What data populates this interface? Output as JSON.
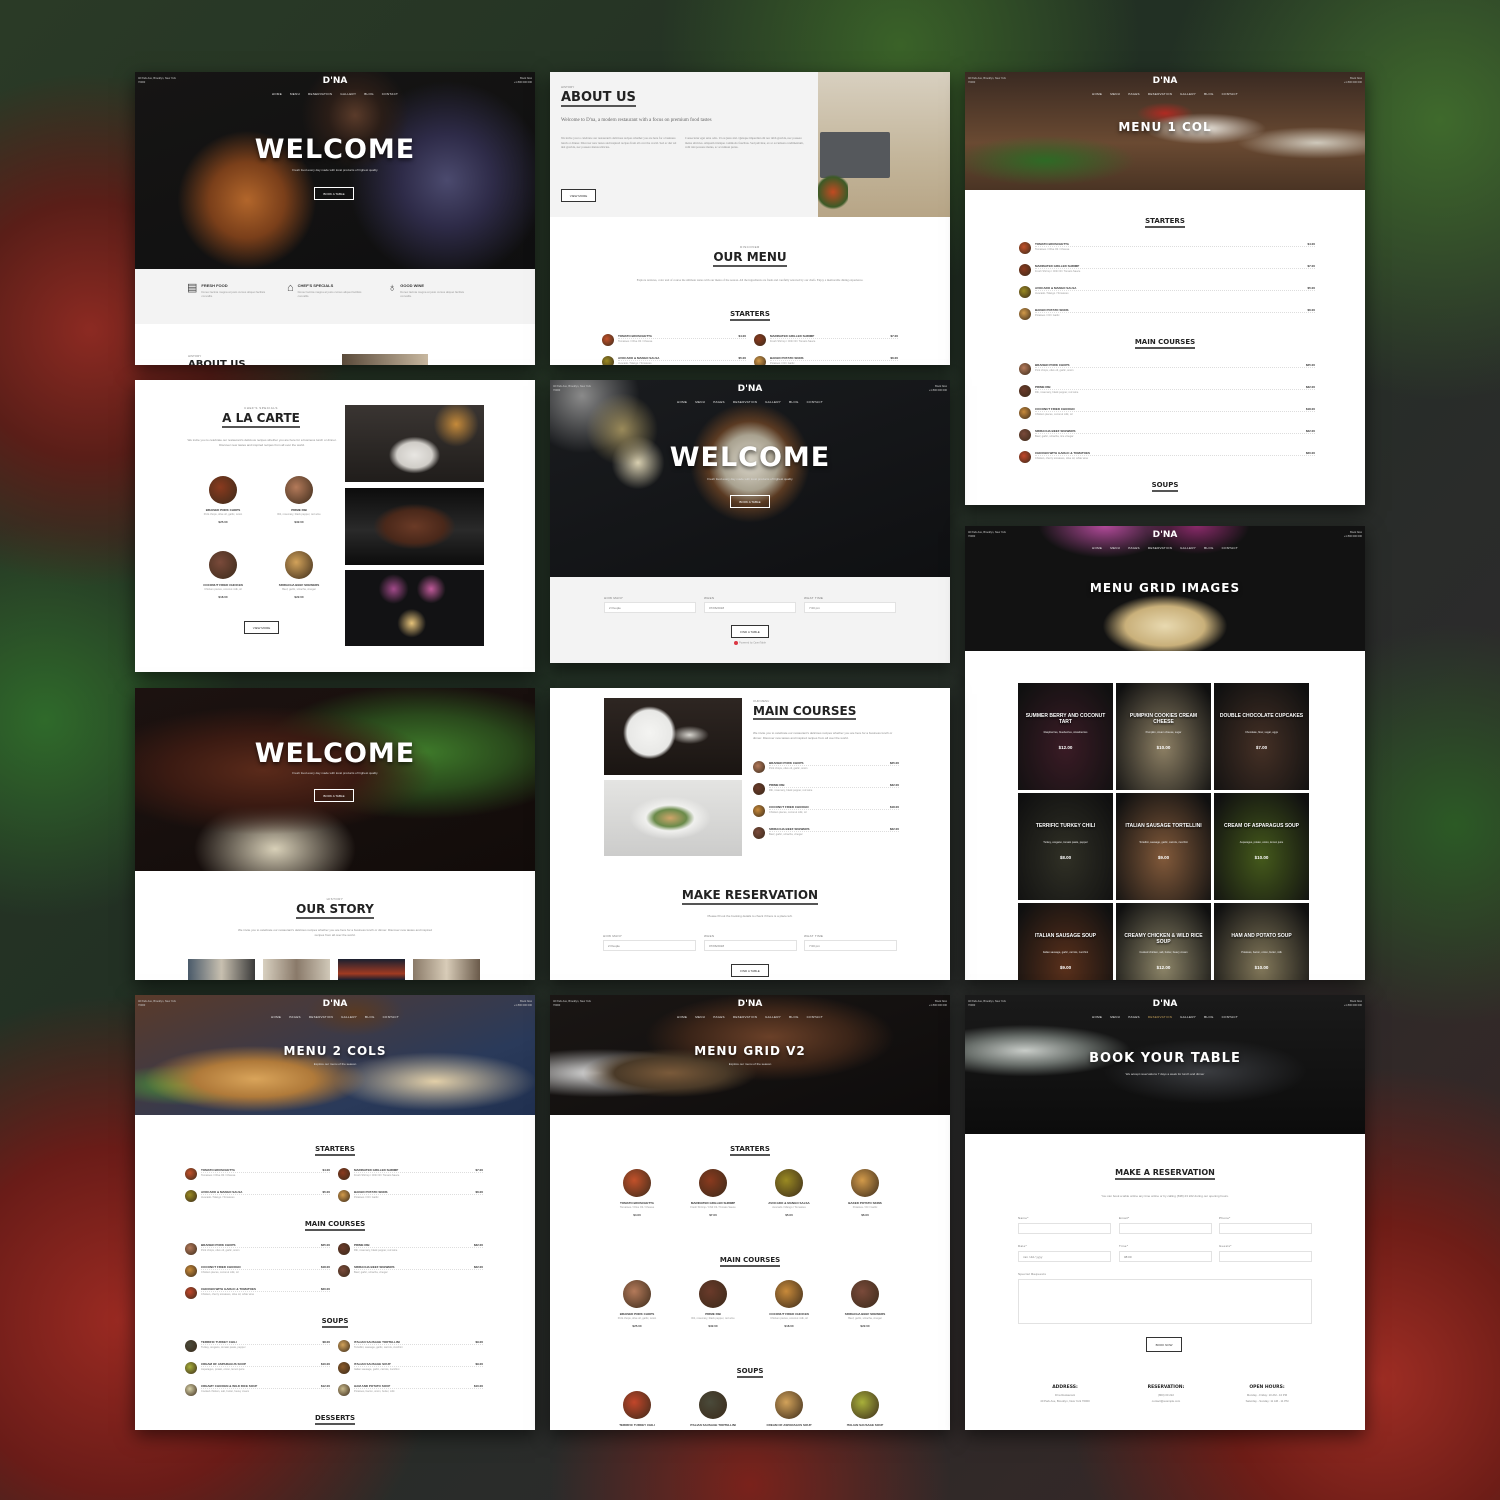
{
  "brand": {
    "logo": "D'NA"
  },
  "nav": {
    "items": [
      "HOME",
      "MENU",
      "PAGES",
      "RESERVATION",
      "GALLERY",
      "BLOG",
      "CONTACT"
    ],
    "address": "40 Park Ave, Brooklyn, New York 70000",
    "hours_label": "Book Now",
    "phone": "+1 800 000 000"
  },
  "cards": {
    "home1": {
      "hero_title": "WELCOME",
      "hero_subtitle": "Fresh food every day made with local products of highest quality",
      "hero_button": "BOOK A TABLE",
      "features": [
        {
          "icon": "fresh-food-icon",
          "glyph": "🥫",
          "title": "FRESH FOOD",
          "desc": "Donec lacinia magna at justo cursus aliquet facilisis convallis."
        },
        {
          "icon": "cloche-icon",
          "glyph": "🛎",
          "title": "CHEF'S SPECIALS",
          "desc": "Donec lacinia magna at justo cursus aliquet facilisis convallis."
        },
        {
          "icon": "wine-glass-icon",
          "glyph": "🍷",
          "title": "GOOD WINE",
          "desc": "Donec lacinia magna at justo cursus aliquet facilisis convallis."
        }
      ],
      "footer_kicker": "HISTORY",
      "footer_title": "ABOUT US"
    },
    "about": {
      "kicker": "HISTORY",
      "title": "ABOUT US",
      "lead": "Welcome to D'na, a modern restaurant with a focus on premium food tastes",
      "col1": "We invite you to celebrate our restaurant's delicious recipes whether you are here for a business lunch or dinner. Discover new tastes and inspired recipes from all over the world. Sed ac dui vel nisl gravida, nec posuere metus ultricies.",
      "col2": "Consectetur eget urna odio. Ut eu justo nisl. Quisque imperdiet elit nec nibh gravida, nec posuere metus ultricies. Aliquam tristique commodo faucibus. Sed pulvinar, ex ac accumsan condimentum, velit nisi posuere metus, ac accumsan purus.",
      "button": "VIEW MORE",
      "menu_kicker": "DISCOVER",
      "menu_title": "OUR MENU",
      "menu_desc": "Explore textures, color and of course the ultimate tastes with our menu of the season. All the ingredients are fresh and carefully selected by our chefs. Enjoy a memorable dining experience.",
      "starters_title": "STARTERS",
      "starters": [
        {
          "name": "TOMATO BRUSCHETTA",
          "desc": "Tomatoes / Olive Oil / Cheese",
          "price": "$4.00"
        },
        {
          "name": "MARINATED GRILLED SHRIMP",
          "desc": "Fresh Shrimp / Chili Oil / Tomato Sauce",
          "price": "$7.00"
        },
        {
          "name": "AVOCADO & MANGO SALSA",
          "desc": "Avocado / Mango / Tomatoes",
          "price": "$5.00"
        },
        {
          "name": "BAKED POTATO SKINS",
          "desc": "Potatoes / Oil / Garlic",
          "price": "$6.00"
        }
      ]
    },
    "menu1col": {
      "title": "MENU 1 COL",
      "sections": [
        {
          "title": "STARTERS",
          "items": [
            {
              "name": "TOMATO BRUSCHETTA",
              "desc": "Tomatoes / Olive Oil / Cheese",
              "price": "$4.00"
            },
            {
              "name": "MARINATED GRILLED SHRIMP",
              "desc": "Fresh Shrimp / Chili Oil / Tomato Sauce",
              "price": "$7.00"
            },
            {
              "name": "AVOCADO & MANGO SALSA",
              "desc": "Avocado / Mango / Tomatoes",
              "price": "$5.00"
            },
            {
              "name": "BAKED POTATO SKINS",
              "desc": "Potatoes / Oil / Garlic",
              "price": "$6.00"
            }
          ]
        },
        {
          "title": "MAIN COURSES",
          "items": [
            {
              "name": "BRAISED PORK CHOPS",
              "desc": "Pork chops, olive oil, garlic, onion",
              "price": "$25.00"
            },
            {
              "name": "PRIME RIB",
              "desc": "Rib, rosemary, black pepper, red wine",
              "price": "$32.00"
            },
            {
              "name": "COCONUT FRIED CHICKEN",
              "desc": "Chicken pieces, coconut milk, oil",
              "price": "$18.00"
            },
            {
              "name": "SRIRACHA BEEF SKEWERS",
              "desc": "Beef, garlic, sriracha, rice vinegar",
              "price": "$22.00"
            },
            {
              "name": "CHICKEN WITH GARLIC & TOMATOES",
              "desc": "Chicken, cherry tomatoes, olive oil, white wine",
              "price": "$20.00"
            }
          ]
        },
        {
          "title": "SOUPS",
          "items": []
        }
      ]
    },
    "alacarte": {
      "kicker": "CHEF'S SPECIALS",
      "title": "A LA CARTE",
      "desc": "We invite you to celebrate our restaurant's delicious recipes whether you are here for a business lunch or dinner. Discover new tastes and inspired recipes from all over the world.",
      "items": [
        {
          "name": "BRAISED PORK CHOPS",
          "desc": "Pork chops, olive oil, garlic, onion",
          "price": "$25.00"
        },
        {
          "name": "PRIME RIB",
          "desc": "Rib, rosemary, black pepper, red wine",
          "price": "$32.00"
        },
        {
          "name": "COCONUT FRIED CHICKEN",
          "desc": "Chicken pieces, coconut milk, oil",
          "price": "$18.00"
        },
        {
          "name": "SRIRACHA BEEF SKEWERS",
          "desc": "Beef, garlic, sriracha, vinegar",
          "price": "$22.00"
        }
      ],
      "button": "VIEW MORE"
    },
    "home2": {
      "hero_title": "WELCOME",
      "hero_subtitle": "Fresh food every day made with local products of highest quality",
      "hero_button": "BOOK A TABLE",
      "form": {
        "how_many_label": "HOW MANY",
        "how_many_value": "2 People",
        "when_label": "WHEN",
        "when_value": "07/06/2018",
        "time_label": "WHAT TIME",
        "time_value": "7:00 pm",
        "button": "FIND A TABLE",
        "powered": "Powered by OpenTable"
      }
    },
    "menugrid": {
      "title": "MENU GRID IMAGES",
      "items": [
        {
          "name": "SUMMER BERRY AND COCONUT TART",
          "desc": "Raspberries, blueberries, strawberries",
          "price": "$12.00"
        },
        {
          "name": "PUMPKIN COOKIES CREAM CHEESE",
          "desc": "Pumpkin, cream cheese, sugar",
          "price": "$10.00"
        },
        {
          "name": "DOUBLE CHOCOLATE CUPCAKES",
          "desc": "Chocolate, flour, sugar, eggs",
          "price": "$7.00"
        },
        {
          "name": "TERRIFIC TURKEY CHILI",
          "desc": "Turkey, oregano, tomato paste, pepper",
          "price": "$8.00"
        },
        {
          "name": "ITALIAN SAUSAGE TORTELLINI",
          "desc": "Tortellini, sausage, garlic, carrots, zucchini",
          "price": "$9.00"
        },
        {
          "name": "CREAM OF ASPARAGUS SOUP",
          "desc": "Asparagus, potato, onion, lemon juice",
          "price": "$10.00"
        },
        {
          "name": "ITALIAN SAUSAGE SOUP",
          "desc": "Italian sausage, garlic, carrots, zucchini",
          "price": "$9.00"
        },
        {
          "name": "CREAMY CHICKEN & WILD RICE SOUP",
          "desc": "Cooked chicken, salt, butter, heavy cream",
          "price": "$12.00"
        },
        {
          "name": "HAM AND POTATO SOUP",
          "desc": "Potatoes, bacon, onion, butter, milk",
          "price": "$10.00"
        }
      ]
    },
    "home3": {
      "hero_title": "WELCOME",
      "hero_subtitle": "Fresh food every day made with local products of highest quality",
      "hero_button": "BOOK A TABLE",
      "kicker": "HISTORY",
      "title": "OUR STORY",
      "desc": "We invite you to celebrate our restaurant's delicious recipes whether you are here for a business lunch or dinner. Discover new tastes and inspired recipes from all over the world."
    },
    "mains": {
      "kicker": "OUR MENU",
      "title": "MAIN COURSES",
      "desc": "We invite you to celebrate our restaurant's delicious recipes whether you are here for a business lunch or dinner. Discover new tastes and inspired recipes from all over the world.",
      "items": [
        {
          "name": "BRAISED PORK CHOPS",
          "desc": "Pork chops, olive oil, garlic, onion",
          "price": "$25.00"
        },
        {
          "name": "PRIME RIB",
          "desc": "Rib, rosemary, black pepper, red wine",
          "price": "$32.00"
        },
        {
          "name": "COCONUT FRIED CHICKEN",
          "desc": "Chicken pieces, coconut milk, oil",
          "price": "$18.00"
        },
        {
          "name": "SRIRACHA BEEF SKEWERS",
          "desc": "Beef, garlic, sriracha, vinegar",
          "price": "$22.00"
        }
      ],
      "res_title": "MAKE RESERVATION",
      "res_desc": "Please fill out the booking details to check if there is a place left.",
      "form": {
        "how_many_label": "HOW MANY",
        "how_many_value": "2 People",
        "when_label": "WHEN",
        "when_value": "07/06/2018",
        "time_label": "WHAT TIME",
        "time_value": "7:00 pm",
        "button": "FIND A TABLE"
      }
    },
    "menu2cols": {
      "title": "MENU 2 COLS",
      "subtitle": "Explore our menu of the season",
      "sections": [
        {
          "title": "STARTERS",
          "items": [
            {
              "name": "TOMATO BRUSCHETTA",
              "desc": "Tomatoes / Olive Oil / Cheese",
              "price": "$4.00"
            },
            {
              "name": "MARINATED GRILLED SHRIMP",
              "desc": "Fresh Shrimp / Chili Oil / Tomato Sauce",
              "price": "$7.00"
            },
            {
              "name": "AVOCADO & MANGO SALSA",
              "desc": "Avocado / Mango / Tomatoes",
              "price": "$5.00"
            },
            {
              "name": "BAKED POTATO SKINS",
              "desc": "Potatoes / Oil / Garlic",
              "price": "$6.00"
            }
          ]
        },
        {
          "title": "MAIN COURSES",
          "items": [
            {
              "name": "BRAISED PORK CHOPS",
              "desc": "Pork chops, olive oil, garlic, onion",
              "price": "$25.00"
            },
            {
              "name": "PRIME RIB",
              "desc": "Rib, rosemary, black pepper, red wine",
              "price": "$32.00"
            },
            {
              "name": "COCONUT FRIED CHICKEN",
              "desc": "Chicken pieces, coconut milk, oil",
              "price": "$18.00"
            },
            {
              "name": "SRIRACHA BEEF SKEWERS",
              "desc": "Beef, garlic, sriracha, vinegar",
              "price": "$22.00"
            },
            {
              "name": "CHICKEN WITH GARLIC & TOMATOES",
              "desc": "Chicken, cherry tomatoes, olive oil, white wine",
              "price": "$20.00"
            }
          ]
        },
        {
          "title": "SOUPS",
          "items": [
            {
              "name": "TERRIFIC TURKEY CHILI",
              "desc": "Turkey, oregano, tomato paste, pepper",
              "price": "$8.00"
            },
            {
              "name": "ITALIAN SAUSAGE TORTELLINI",
              "desc": "Tortellini, sausage, garlic, carrots, zucchini",
              "price": "$9.00"
            },
            {
              "name": "CREAM OF ASPARAGUS SOUP",
              "desc": "Asparagus, potato, onion, lemon juice",
              "price": "$10.00"
            },
            {
              "name": "ITALIAN SAUSAGE SOUP",
              "desc": "Italian sausage, garlic, carrots, zucchini",
              "price": "$9.00"
            },
            {
              "name": "CREAMY CHICKEN & WILD RICE SOUP",
              "desc": "Cooked chicken, salt, butter, heavy cream",
              "price": "$12.00"
            },
            {
              "name": "HAM AND POTATO SOUP",
              "desc": "Potatoes, bacon, onion, butter, milk",
              "price": "$10.00"
            }
          ]
        },
        {
          "title": "DESSERTS",
          "items": []
        }
      ]
    },
    "menugridv2": {
      "title": "MENU GRID V2",
      "subtitle": "Explore our menu of the season",
      "sections": [
        {
          "title": "STARTERS",
          "items": [
            {
              "name": "TOMATO BRUSCHETTA",
              "desc": "Tomatoes / Olive Oil / Cheese",
              "price": "$4.00"
            },
            {
              "name": "MARINATED GRILLED SHRIMP",
              "desc": "Fresh Shrimp / Chili Oil / Tomato Sauce",
              "price": "$7.00"
            },
            {
              "name": "AVOCADO & MANGO SALSA",
              "desc": "Avocado / Mango / Tomatoes",
              "price": "$5.00"
            },
            {
              "name": "BAKED POTATO SKINS",
              "desc": "Potatoes / Oil / Garlic",
              "price": "$6.00"
            }
          ]
        },
        {
          "title": "MAIN COURSES",
          "items": [
            {
              "name": "BRAISED PORK CHOPS",
              "desc": "Pork chops, olive oil, garlic, onion",
              "price": "$25.00"
            },
            {
              "name": "PRIME RIB",
              "desc": "Rib, rosemary, black pepper, red wine",
              "price": "$32.00"
            },
            {
              "name": "COCONUT FRIED CHICKEN",
              "desc": "Chicken pieces, coconut milk, oil",
              "price": "$18.00"
            },
            {
              "name": "SRIRACHA BEEF SKEWERS",
              "desc": "Beef, garlic, sriracha, vinegar",
              "price": "$22.00"
            }
          ]
        },
        {
          "title": "SOUPS",
          "items": [
            {
              "name": "TERRIFIC TURKEY CHILI",
              "desc": "",
              "price": ""
            },
            {
              "name": "ITALIAN SAUSAGE TORTELLINI",
              "desc": "",
              "price": ""
            },
            {
              "name": "CREAM OF ASPARAGUS SOUP",
              "desc": "",
              "price": ""
            },
            {
              "name": "ITALIAN SAUSAGE SOUP",
              "desc": "",
              "price": ""
            }
          ]
        }
      ]
    },
    "booktable": {
      "title": "BOOK YOUR TABLE",
      "subtitle": "We accept reservations 7 days a week for lunch and dinner",
      "section_title": "MAKE A RESERVATION",
      "desc": "You can book a table online any time online or by calling (638) 23 222 during our opening hours.",
      "fields": {
        "name_label": "Name*",
        "email_label": "Email*",
        "phone_label": "Phone*",
        "date_label": "Date*",
        "date_placeholder": "mm / dd / yyyy",
        "time_label": "Time*",
        "time_value": "08:00",
        "guests_label": "Guests*",
        "requests_label": "Special Requests"
      },
      "button": "BOOK NOW",
      "info": [
        {
          "title": "ADDRESS:",
          "line1": "D'na Restaurant",
          "line2": "40 Park Ave, Brooklyn, New York 70000"
        },
        {
          "title": "RESERVATION:",
          "line1": "(800) 00 222",
          "line2": "contact@example.com"
        },
        {
          "title": "OPEN HOURS:",
          "line1": "Monday - Friday: 10 AM - 10 PM",
          "line2": "Saturday - Sunday: 11 AM - 11 PM"
        }
      ]
    }
  },
  "colors": {
    "text_dark": "#222222",
    "accent_nav": "#c9a45c",
    "bg_light": "#f3f3f3"
  }
}
